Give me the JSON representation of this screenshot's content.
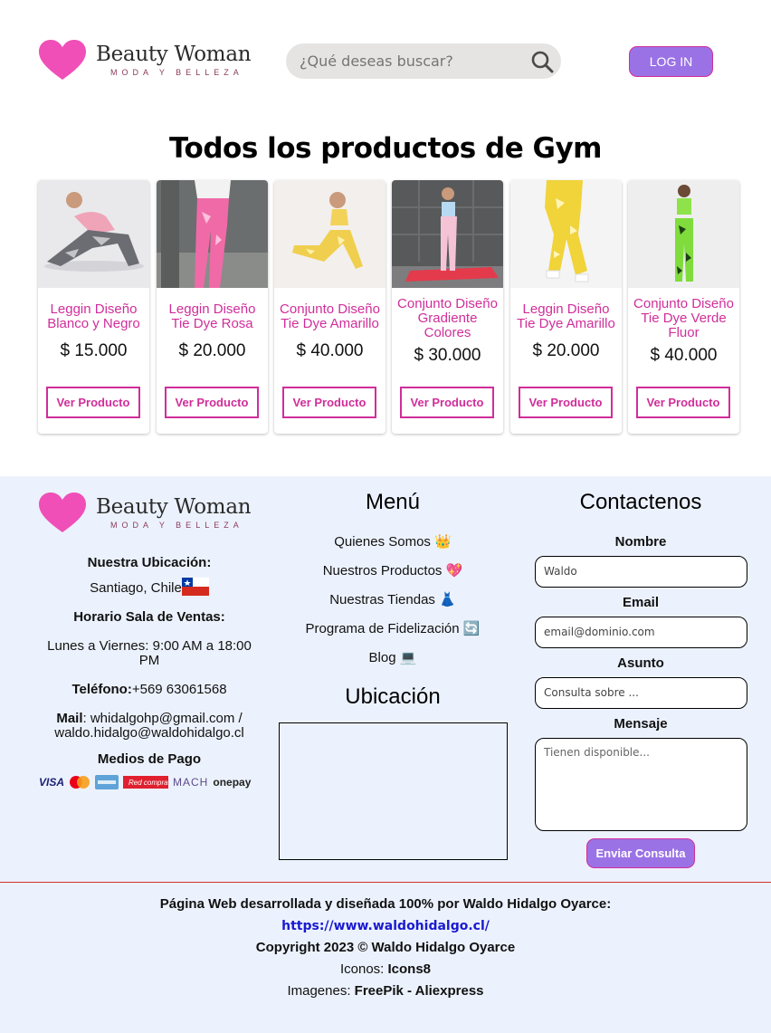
{
  "header": {
    "brand_name": "Beauty Woman",
    "brand_sub": "MODA Y BELLEZA",
    "search_placeholder": "¿Qué deseas buscar?",
    "login_label": "LOG IN"
  },
  "page_title": "Todos los productos de Gym",
  "products": [
    {
      "name": "Leggin Diseño Blanco y Negro",
      "price": "$ 15.000",
      "button": "Ver Producto"
    },
    {
      "name": "Leggin Diseño Tie Dye Rosa",
      "price": "$ 20.000",
      "button": "Ver Producto"
    },
    {
      "name": "Conjunto Diseño Tie Dye Amarillo",
      "price": "$ 40.000",
      "button": "Ver Producto"
    },
    {
      "name": "Conjunto Diseño Gradiente Colores",
      "price": "$ 30.000",
      "button": "Ver Producto"
    },
    {
      "name": "Leggin Diseño Tie Dye Amarillo",
      "price": "$ 20.000",
      "button": "Ver Producto"
    },
    {
      "name": "Conjunto Diseño Tie Dye Verde Fluor",
      "price": "$ 40.000",
      "button": "Ver Producto"
    }
  ],
  "footer": {
    "brand_name": "Beauty Woman",
    "brand_sub": "MODA Y BELLEZA",
    "location_label": "Nuestra Ubicación:",
    "location_value": "Santiago, Chile",
    "hours_label": "Horario Sala de Ventas:",
    "hours_value": "Lunes a Viernes: 9:00 AM a 18:00 PM",
    "phone_label": "Teléfono:",
    "phone_value": "+569 63061568",
    "mail_label": "Mail",
    "mail_value": ": whidalgohp@gmail.com / waldo.hidalgo@waldohidalgo.cl",
    "payments_label": "Medios de Pago",
    "payments": [
      "VISA",
      "mastercard",
      "AMERICAN EXPRESS",
      "Red compra",
      "MACH",
      "onepay"
    ],
    "menu_title": "Menú",
    "menu_items": [
      {
        "label": "Quienes Somos",
        "emoji": "👑"
      },
      {
        "label": "Nuestros Productos",
        "emoji": "💖"
      },
      {
        "label": "Nuestras Tiendas",
        "emoji": "👗"
      },
      {
        "label": "Programa de Fidelización",
        "emoji": "🔄"
      },
      {
        "label": "Blog",
        "emoji": "💻"
      }
    ],
    "ubicacion_title": "Ubicación",
    "contact_title": "Contactenos",
    "contact": {
      "name_label": "Nombre",
      "name_value": "Waldo",
      "email_label": "Email",
      "email_placeholder": "email@dominio.com",
      "subject_label": "Asunto",
      "subject_placeholder": "Consulta sobre ...",
      "message_label": "Mensaje",
      "message_placeholder": "Tienen disponible...",
      "send_label": "Enviar Consulta"
    },
    "credits": {
      "line1": "Página Web desarrollada y diseñada 100% por Waldo Hidalgo Oyarce:",
      "link": "https://www.waldohidalgo.cl/",
      "copyright": "Copyright 2023 © Waldo Hidalgo Oyarce",
      "icons_label": "Iconos: ",
      "icons_value": "Icons8",
      "images_label": "Imagenes: ",
      "images_value": "FreePik - Aliexpress"
    }
  },
  "colors": {
    "accent": "#d02e9a",
    "button_bg": "#9b72e6",
    "footer_bg": "#ecf2fd",
    "heart": "#f04fb8"
  }
}
